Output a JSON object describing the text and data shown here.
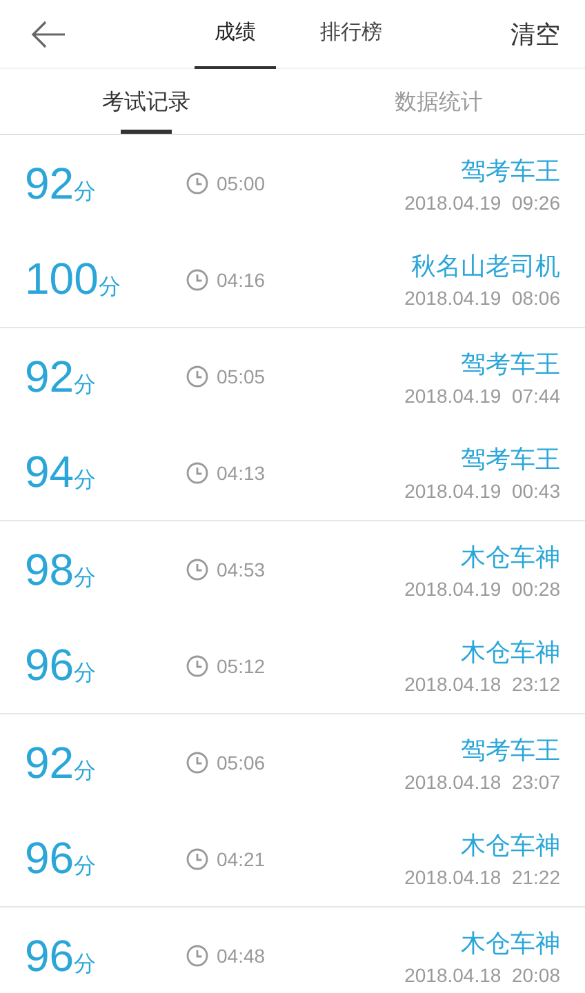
{
  "header": {
    "tabs": [
      {
        "label": "成绩",
        "selected": true
      },
      {
        "label": "排行榜",
        "selected": false
      }
    ],
    "action": "清空"
  },
  "subtabs": [
    {
      "label": "考试记录",
      "selected": true
    },
    {
      "label": "数据统计",
      "selected": false
    }
  ],
  "records": [
    {
      "score": "92",
      "unit": "分",
      "duration": "05:00",
      "name": "驾考车王",
      "date": "2018.04.19  09:26"
    },
    {
      "score": "100",
      "unit": "分",
      "duration": "04:16",
      "name": "秋名山老司机",
      "date": "2018.04.19  08:06"
    },
    {
      "score": "92",
      "unit": "分",
      "duration": "05:05",
      "name": "驾考车王",
      "date": "2018.04.19  07:44"
    },
    {
      "score": "94",
      "unit": "分",
      "duration": "04:13",
      "name": "驾考车王",
      "date": "2018.04.19  00:43"
    },
    {
      "score": "98",
      "unit": "分",
      "duration": "04:53",
      "name": "木仓车神",
      "date": "2018.04.19  00:28"
    },
    {
      "score": "96",
      "unit": "分",
      "duration": "05:12",
      "name": "木仓车神",
      "date": "2018.04.18  23:12"
    },
    {
      "score": "92",
      "unit": "分",
      "duration": "05:06",
      "name": "驾考车王",
      "date": "2018.04.18  23:07"
    },
    {
      "score": "96",
      "unit": "分",
      "duration": "04:21",
      "name": "木仓车神",
      "date": "2018.04.18  21:22"
    },
    {
      "score": "96",
      "unit": "分",
      "duration": "04:48",
      "name": "木仓车神",
      "date": "2018.04.18  20:08"
    }
  ]
}
